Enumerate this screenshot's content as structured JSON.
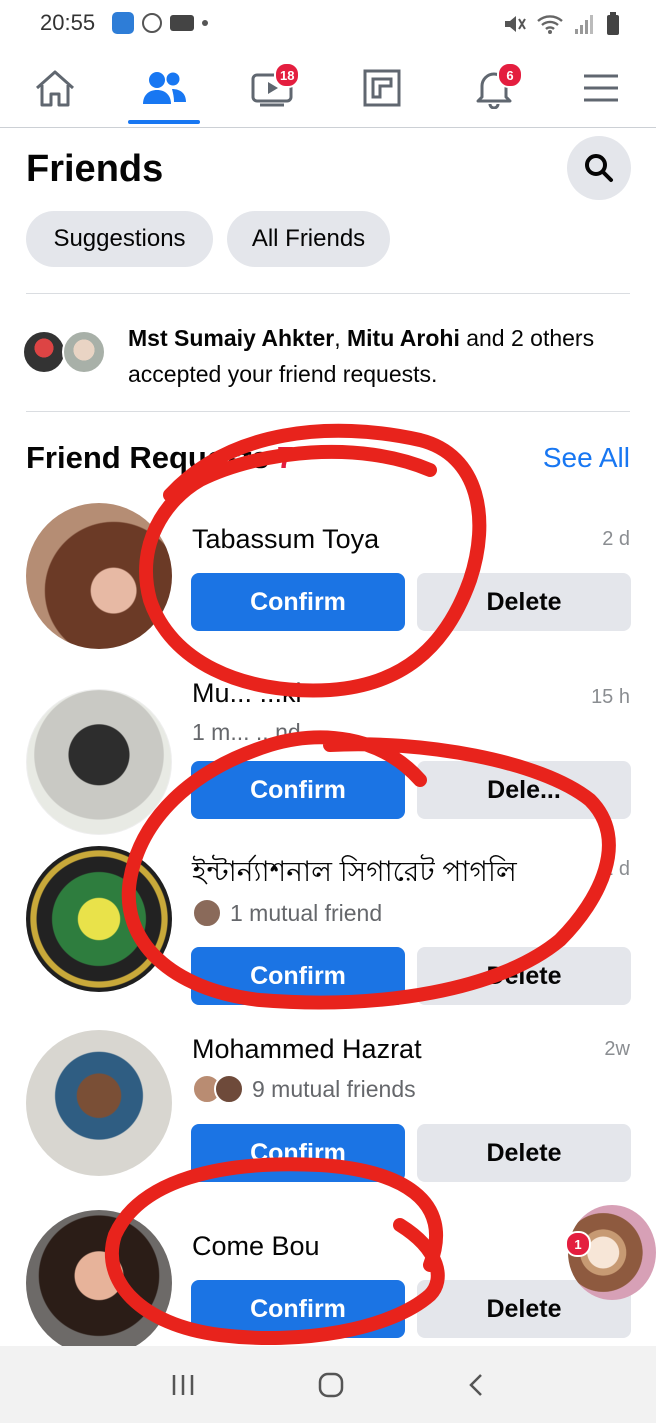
{
  "status_bar": {
    "time": "20:55"
  },
  "nav": {
    "tabs": [
      {
        "name": "home",
        "badge": ""
      },
      {
        "name": "friends",
        "badge": ""
      },
      {
        "name": "watch",
        "badge": "18"
      },
      {
        "name": "pages",
        "badge": ""
      },
      {
        "name": "notifications",
        "badge": "6"
      },
      {
        "name": "menu",
        "badge": ""
      }
    ],
    "active": "friends"
  },
  "header": {
    "title": "Friends"
  },
  "pills": {
    "suggestions": "Suggestions",
    "all_friends": "All Friends"
  },
  "accepted": {
    "name1": "Mst Sumaiy Ahkter",
    "separator": ", ",
    "name2": "Mitu Arohi",
    "rest": " and 2 others accepted your friend requests."
  },
  "requests_section": {
    "title": "Friend Requests",
    "count": "7",
    "see_all": "See All"
  },
  "requests": [
    {
      "name": "Tabassum Toya",
      "time": "2 d",
      "mutual": "",
      "confirm": "Confirm",
      "delete": "Delete"
    },
    {
      "name": "Mu... ...ki",
      "time": "15 h",
      "mutual": "1 m... ...nd",
      "confirm": "Confirm",
      "delete": "Dele..."
    },
    {
      "name": "ইন্টার্ন্যাশনাল সিগারেট পাগলি",
      "time": "1 d",
      "mutual": "1 mutual friend",
      "confirm": "Confirm",
      "delete": "Delete"
    },
    {
      "name": "Mohammed Hazrat",
      "time": "2w",
      "mutual": "9 mutual friends",
      "confirm": "Confirm",
      "delete": "Delete"
    },
    {
      "name": "Come Bou",
      "time": "",
      "mutual": "",
      "confirm": "Confirm",
      "delete": "Delete"
    }
  ],
  "chat_head": {
    "badge": "1"
  },
  "colors": {
    "accent": "#1877f2",
    "confirm": "#1b74e4",
    "badge": "#e41e3f",
    "annotation": "#e8231c"
  }
}
